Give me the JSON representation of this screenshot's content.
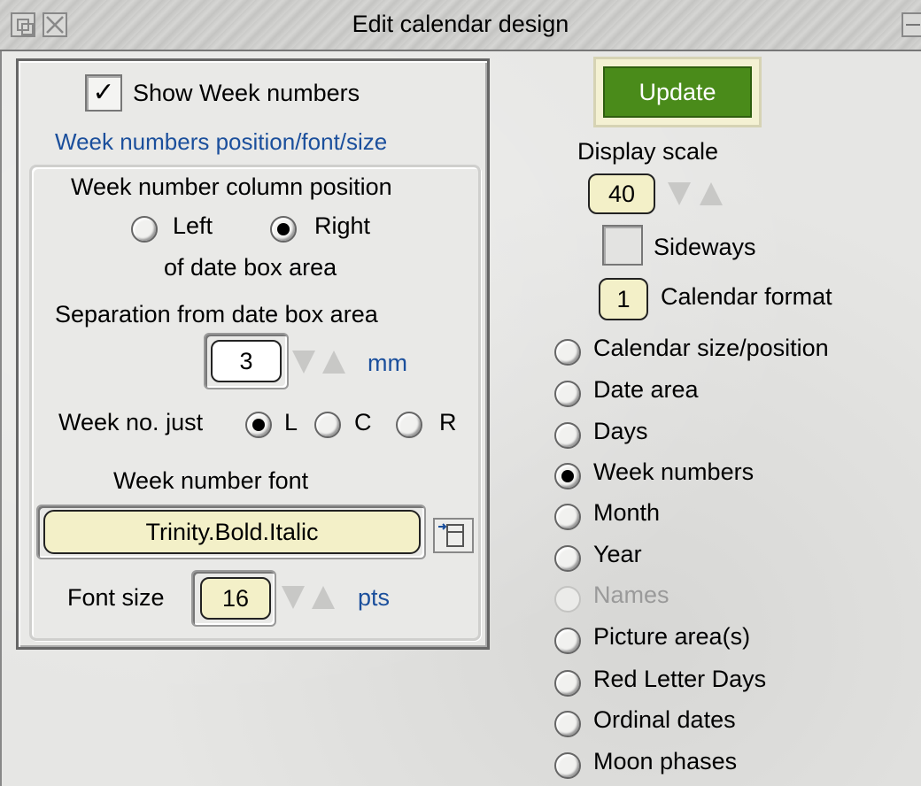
{
  "window": {
    "title": "Edit calendar design"
  },
  "left": {
    "show_week_numbers": {
      "label": "Show Week numbers",
      "checked": true,
      "check_glyph": "✓"
    },
    "section_title": "Week numbers position/font/size",
    "column_position": {
      "heading": "Week number column position",
      "left_label": "Left",
      "right_label": "Right",
      "selected": "Right",
      "sublabel": "of date box area"
    },
    "separation": {
      "heading": "Separation from date box area",
      "value": "3",
      "unit": "mm"
    },
    "justification": {
      "label": "Week no. just",
      "options": [
        "L",
        "C",
        "R"
      ],
      "selected": "L"
    },
    "font": {
      "heading": "Week number font",
      "value": "Trinity.Bold.Italic"
    },
    "font_size": {
      "label": "Font size",
      "value": "16",
      "unit": "pts"
    }
  },
  "right": {
    "update_label": "Update",
    "display_scale": {
      "label": "Display scale",
      "value": "40"
    },
    "sideways": {
      "label": "Sideways",
      "checked": false
    },
    "calendar_format": {
      "value": "1",
      "label": "Calendar format"
    },
    "sections": [
      {
        "label": "Calendar size/position",
        "selected": false,
        "disabled": false
      },
      {
        "label": "Date area",
        "selected": false,
        "disabled": false
      },
      {
        "label": "Days",
        "selected": false,
        "disabled": false
      },
      {
        "label": "Week numbers",
        "selected": true,
        "disabled": false
      },
      {
        "label": "Month",
        "selected": false,
        "disabled": false
      },
      {
        "label": "Year",
        "selected": false,
        "disabled": false
      },
      {
        "label": "Names",
        "selected": false,
        "disabled": true
      },
      {
        "label": "Picture area(s)",
        "selected": false,
        "disabled": false
      },
      {
        "label": "Red Letter Days",
        "selected": false,
        "disabled": false
      },
      {
        "label": "Ordinal dates",
        "selected": false,
        "disabled": false
      },
      {
        "label": "Moon phases",
        "selected": false,
        "disabled": false
      }
    ]
  },
  "colors": {
    "accent_blue": "#1b4f9c",
    "update_green": "#4a8b1a",
    "field_yellow": "#f3f0c8"
  },
  "icons": [
    "back-icon",
    "close-icon",
    "toggle-size-icon",
    "menu-icon"
  ]
}
